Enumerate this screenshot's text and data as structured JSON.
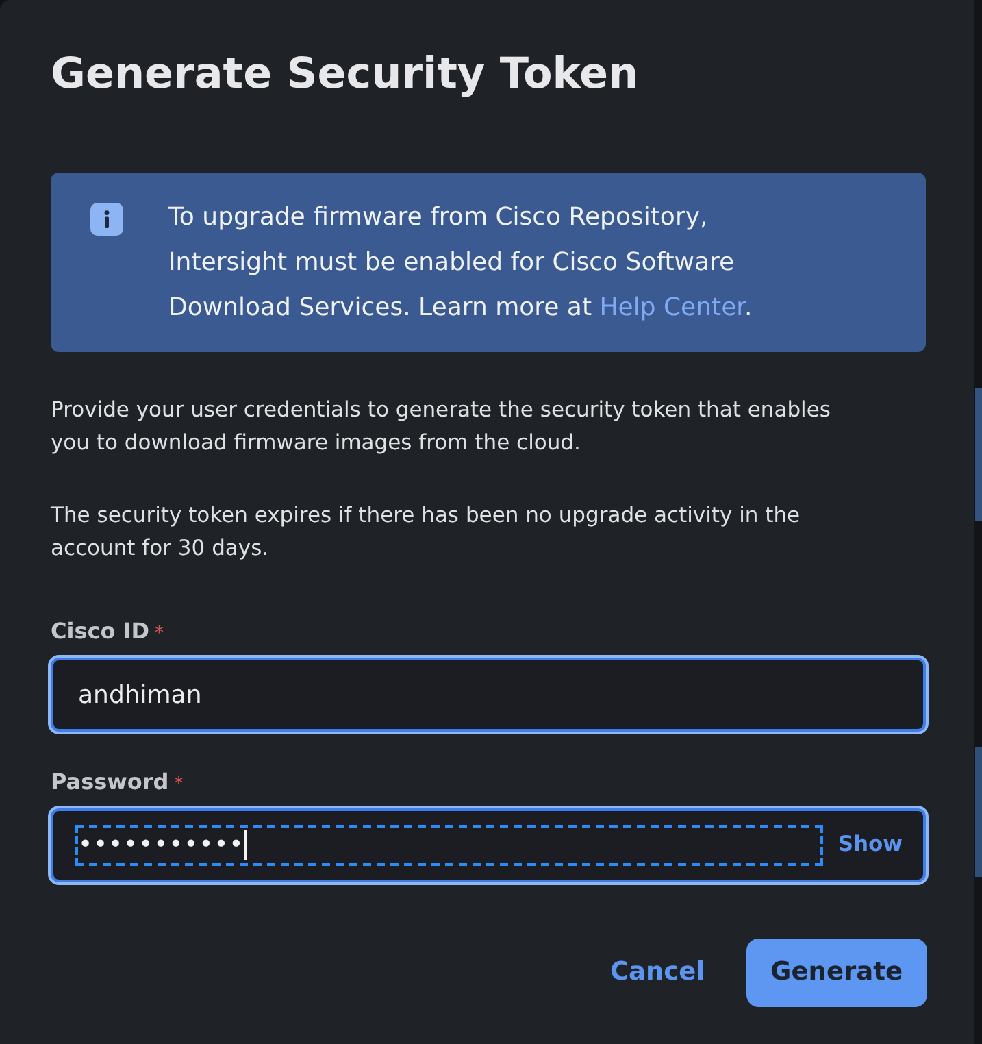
{
  "dialog": {
    "title": "Generate Security Token"
  },
  "info_banner": {
    "text_before": "To upgrade firmware from Cisco Repository, Intersight must be enabled for Cisco Software Download Services. Learn more at ",
    "link": "Help Center",
    "text_after": "."
  },
  "paragraphs": [
    "Provide your user credentials to generate the security token that enables you to download firmware images from the cloud.",
    "The security token expires if there has been no upgrade activity in the account for 30 days."
  ],
  "fields": [
    {
      "kind": "text",
      "label": "Cisco ID",
      "required_mark": "*",
      "value": "andhiman",
      "focused": false
    },
    {
      "kind": "password",
      "label": "Password",
      "required_mark": "*",
      "value": "•••••••••••",
      "focused": true,
      "toggle": "Show"
    }
  ],
  "buttons": [
    {
      "kind": "link",
      "label": "Cancel"
    },
    {
      "kind": "primary",
      "label": "Generate"
    }
  ]
}
